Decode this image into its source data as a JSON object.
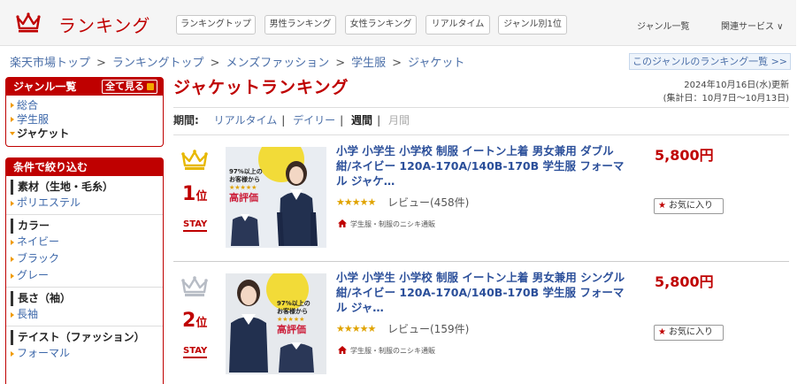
{
  "header": {
    "title": "ランキング",
    "tabs": [
      "ランキングトップ",
      "男性ランキング",
      "女性ランキング",
      "リアルタイム",
      "ジャンル別1位"
    ],
    "links": [
      "ジャンル一覧",
      "関連サービス ∨"
    ]
  },
  "breadcrumb": [
    "楽天市場トップ",
    "ランキングトップ",
    "メンズファッション",
    "学生服",
    "ジャケット"
  ],
  "breadcrumb_sep": ">",
  "genre_list_link": "このジャンルのランキング一覧 >>",
  "sidebar": {
    "genre": {
      "title": "ジャンル一覧",
      "see_all": "全て見る",
      "items": [
        "総合",
        "学生服",
        "ジャケット"
      ]
    },
    "filter": {
      "title": "条件で絞り込む",
      "groups": [
        {
          "name": "素材（生地・毛糸）",
          "items": [
            "ポリエステル"
          ]
        },
        {
          "name": "カラー",
          "items": [
            "ネイビー",
            "ブラック",
            "グレー"
          ]
        },
        {
          "name": "長さ（袖）",
          "items": [
            "長袖"
          ]
        },
        {
          "name": "テイスト（ファッション）",
          "items": [
            "フォーマル"
          ]
        }
      ]
    }
  },
  "main": {
    "title": "ジャケットランキング",
    "updated": "2024年10月16日(水)更新",
    "period_total": "(集計日：10月7日〜10月13日)",
    "period_label": "期間:",
    "periods": [
      "リアルタイム",
      "デイリー",
      "週間",
      "月間"
    ],
    "items": [
      {
        "rank": "1",
        "rank_suffix": "位",
        "status": "STAY",
        "crown": "gold",
        "title": "小学 小学生 小学校 制服 イートン上着 男女兼用 ダブル 紺/ネイビー 120A-170A/140B-170B 学生服 フォーマル ジャケ…",
        "stars": "★★★★★",
        "review": "レビュー(458件)",
        "shop": "学生服・制服のニシキ通販",
        "price": "5,800円",
        "fav": "お気に入り",
        "thumb_text": [
          "97%以上の",
          "お客様から",
          "★★★★★",
          "高評価"
        ]
      },
      {
        "rank": "2",
        "rank_suffix": "位",
        "status": "STAY",
        "crown": "silver",
        "title": "小学 小学生 小学校 制服 イートン上着 男女兼用 シングル 紺/ネイビー 120A-170A/140B-170B 学生服 フォーマル ジャ…",
        "stars": "★★★★★",
        "review": "レビュー(159件)",
        "shop": "学生服・制服のニシキ通販",
        "price": "5,800円",
        "fav": "お気に入り",
        "thumb_text": [
          "97%以上の",
          "お客様から",
          "★★★★★",
          "高評価"
        ]
      }
    ]
  },
  "colors": {
    "brand": "#bf0000",
    "link": "#3c67a9",
    "star": "#e0a300",
    "orange": "#f09a00"
  }
}
